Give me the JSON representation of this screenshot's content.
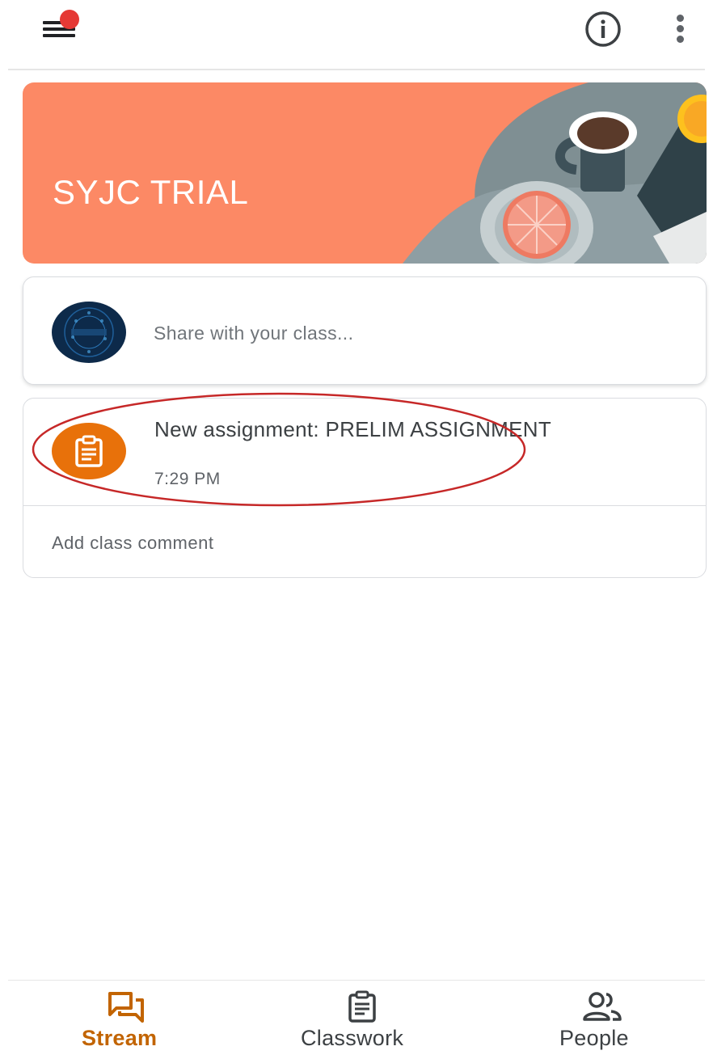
{
  "banner": {
    "class_name": "SYJC TRIAL",
    "color": "#fc8965"
  },
  "share": {
    "placeholder": "Share with your class..."
  },
  "assignment": {
    "title": "New assignment: PRELIM ASSIGNMENT",
    "time": "7:29 PM",
    "icon": "assignment-icon",
    "icon_color": "#e8710a",
    "comment_prompt": "Add class comment"
  },
  "bottom_nav": {
    "items": [
      {
        "label": "Stream",
        "icon": "stream-icon",
        "active": true,
        "color": "#c26401"
      },
      {
        "label": "Classwork",
        "icon": "classwork-icon",
        "active": false
      },
      {
        "label": "People",
        "icon": "people-icon",
        "active": false
      }
    ]
  },
  "icons": {
    "menu": "menu-icon",
    "notification_dot_color": "#e53935",
    "info": "info-icon",
    "more": "more-vert-icon"
  }
}
